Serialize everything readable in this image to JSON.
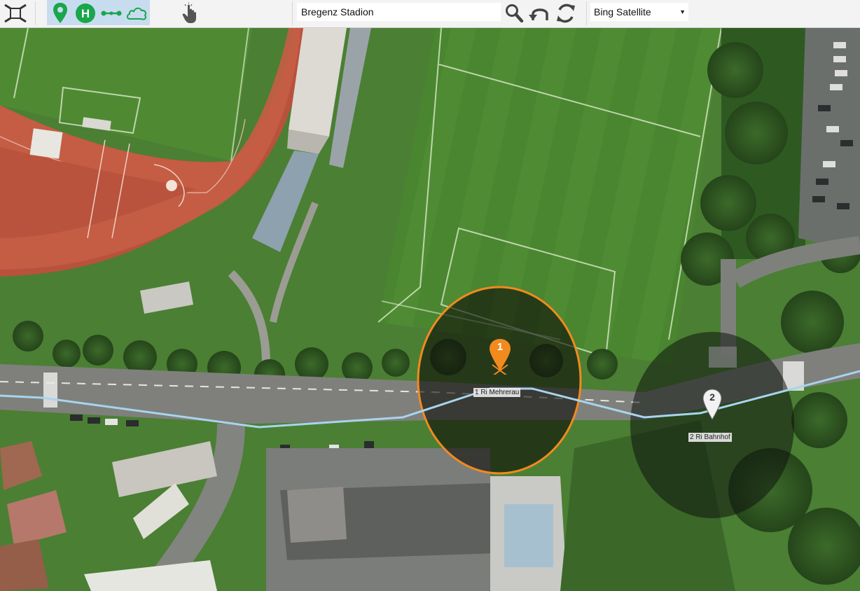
{
  "toolbar": {
    "search_value": "Bregenz Stadion",
    "map_source": "Bing Satellite"
  },
  "icons": {
    "fit": "fit-to-screen-icon",
    "stop_marker": "map-marker-icon",
    "halt": "halt-h-icon",
    "route": "route-line-icon",
    "area": "area-cloud-icon",
    "hand": "hand-pointer-icon",
    "search": "search-icon",
    "undo": "undo-icon",
    "refresh": "refresh-icon",
    "dropdown": "chevron-down-icon"
  },
  "map": {
    "stops": [
      {
        "number": "1",
        "label": "1  Ri Mehrerau",
        "selected": true
      },
      {
        "number": "2",
        "label": "2  Ri Bahnhof",
        "selected": false
      }
    ]
  },
  "colors": {
    "accent_orange": "#f28a1e",
    "route_line": "#a8d4ee",
    "toolbar_bg": "#f3f3f3",
    "group_highlight": "#c8dcf0",
    "icon_green": "#1aa64a"
  }
}
